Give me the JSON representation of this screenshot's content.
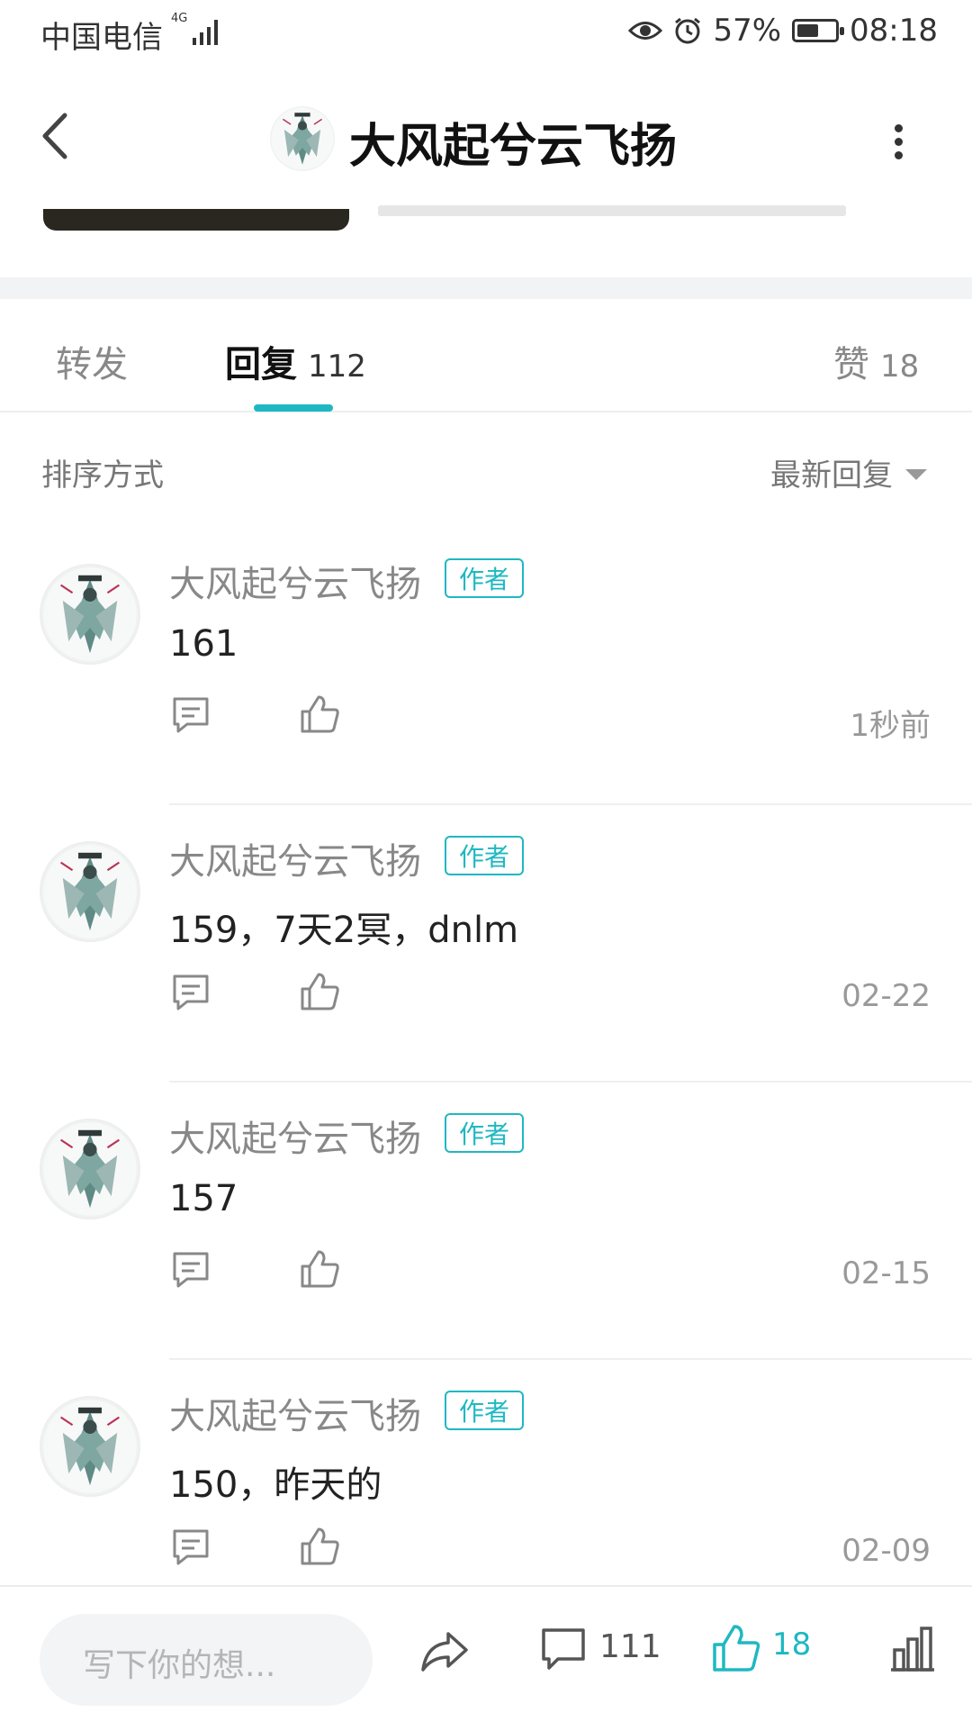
{
  "status_bar": {
    "carrier": "中国电信",
    "network": "4G",
    "battery_percent": "57%",
    "battery_level": 0.57,
    "time": "08:18",
    "icons": [
      "eye-icon",
      "alarm-icon",
      "battery-icon",
      "signal-icon"
    ]
  },
  "header": {
    "title": "大风起兮云飞扬",
    "icons": [
      "back-arrow-icon",
      "more-vertical-icon"
    ]
  },
  "tabs": [
    {
      "label": "转发",
      "count": ""
    },
    {
      "label": "回复",
      "count": "112",
      "active": true
    },
    {
      "label": "赞",
      "count": "18"
    }
  ],
  "sort": {
    "label": "排序方式",
    "value": "最新回复"
  },
  "comments": [
    {
      "author": "大风起兮云飞扬",
      "badge": "作者",
      "text": "161",
      "time": "1秒前"
    },
    {
      "author": "大风起兮云飞扬",
      "badge": "作者",
      "text": "159，7天2冥，dnlm",
      "time": "02-22"
    },
    {
      "author": "大风起兮云飞扬",
      "badge": "作者",
      "text": "157",
      "time": "02-15"
    },
    {
      "author": "大风起兮云飞扬",
      "badge": "作者",
      "text": "150，昨天的",
      "time": "02-09"
    }
  ],
  "bottom_bar": {
    "input_placeholder": "写下你的想...",
    "comment_count": "111",
    "like_count": "18",
    "icons": [
      "share-icon",
      "comment-icon",
      "like-icon",
      "stats-icon"
    ]
  },
  "colors": {
    "accent": "#1fb8c2",
    "text_primary": "#222222",
    "text_secondary": "#888888"
  }
}
